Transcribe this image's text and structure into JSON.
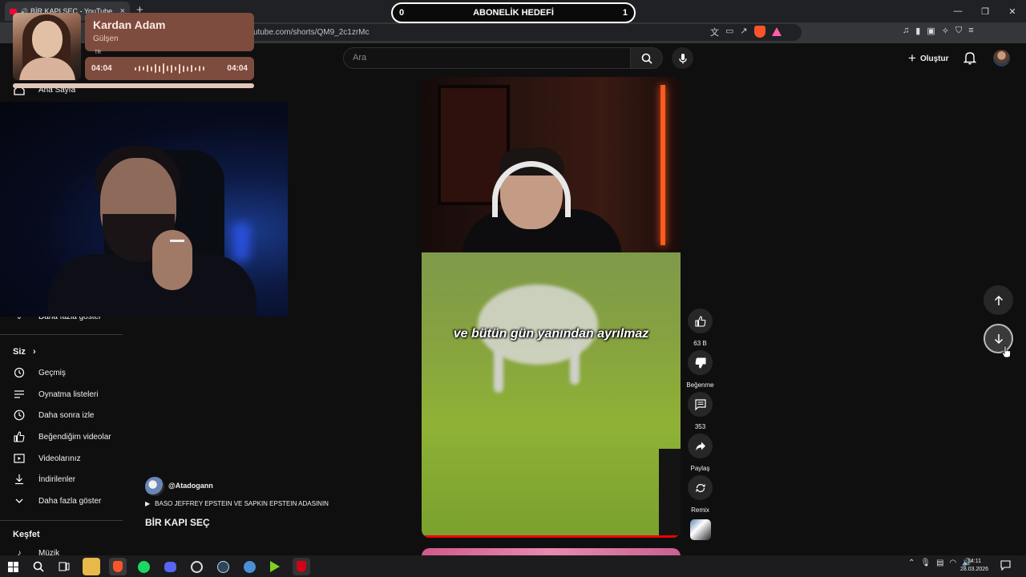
{
  "browser": {
    "tab_title": "BİR KAPI SEÇ - YouTube",
    "new_tab": "+",
    "url": "utube.com/shorts/QM9_2c1zrMc",
    "window_controls": [
      "minimize-icon",
      "restore-icon",
      "close-icon"
    ]
  },
  "overlay_goal": {
    "left_value": "0",
    "label": "ABONELİK HEDEFİ",
    "right_value": "1"
  },
  "music_widget": {
    "title": "Kardan Adam",
    "artist": "Gülşen",
    "lang": "TR",
    "elapsed": "04:04",
    "total": "04:04",
    "progress": 1.0
  },
  "youtube": {
    "search_placeholder": "Ara",
    "create_label": "Oluştur"
  },
  "sidebar": {
    "home_label": "Ana Sayfa",
    "show_more_top": "Daha fazla göster",
    "you_header": "Siz",
    "you_items": [
      {
        "label": "Geçmiş",
        "icon": "history-icon"
      },
      {
        "label": "Oynatma listeleri",
        "icon": "playlist-icon"
      },
      {
        "label": "Daha sonra izle",
        "icon": "watch-later-icon"
      },
      {
        "label": "Beğendiğim videolar",
        "icon": "like-icon"
      },
      {
        "label": "Videolarınız",
        "icon": "your-videos-icon"
      },
      {
        "label": "İndirilenler",
        "icon": "download-icon"
      },
      {
        "label": "Daha fazla göster",
        "icon": "chevron-down-icon"
      }
    ],
    "explore_header": "Keşfet",
    "explore_items": [
      {
        "label": "Müzik",
        "icon": "music-icon"
      }
    ]
  },
  "short": {
    "caption": "ve bütün gün yanından ayrılmaz",
    "channel": "@Atadogann",
    "music_line": "BASO JEFFREY EPSTEIN VE SAPKIN EPSTEIN ADASININ",
    "title": "BİR KAPI SEÇ"
  },
  "actions": {
    "like_count": "63 B",
    "dislike_label": "Beğenme",
    "comment_count": "353",
    "share_label": "Paylaş",
    "remix_label": "Remix"
  },
  "taskbar": {
    "time": "14:11",
    "date": "28.03.2026"
  }
}
